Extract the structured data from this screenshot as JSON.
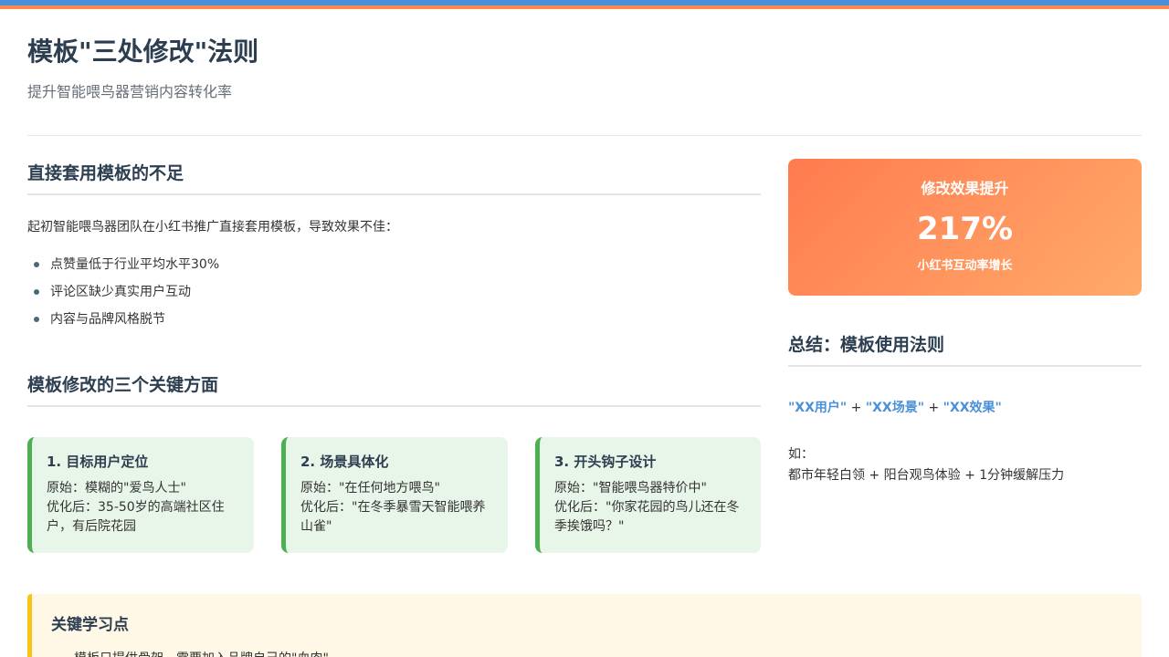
{
  "header": {
    "title": "模板\"三处修改\"法则",
    "subtitle": "提升智能喂鸟器营销内容转化率"
  },
  "problem": {
    "title": "直接套用模板的不足",
    "intro": "起初智能喂鸟器团队在小红书推广直接套用模板，导致效果不佳：",
    "bullets": [
      "点赞量低于行业平均水平30%",
      "评论区缺少真实用户互动",
      "内容与品牌风格脱节"
    ]
  },
  "aspects": {
    "title": "模板修改的三个关键方面",
    "cards": [
      {
        "title": "1. 目标用户定位",
        "lines": [
          "原始：模糊的\"爱鸟人士\"",
          "优化后：35-50岁的高端社区住",
          "户，有后院花园"
        ]
      },
      {
        "title": "2. 场景具体化",
        "lines": [
          "原始：\"在任何地方喂鸟\"",
          "优化后：\"在冬季暴雪天智能喂养",
          "山雀\""
        ]
      },
      {
        "title": "3. 开头钩子设计",
        "lines": [
          "原始：\"智能喂鸟器特价中\"",
          "优化后：\"你家花园的鸟儿还在冬",
          "季挨饿吗？\""
        ]
      }
    ]
  },
  "stat": {
    "label": "修改效果提升",
    "value": "217%",
    "caption": "小红书互动率增长"
  },
  "summary": {
    "title": "总结：模板使用法则",
    "formula": {
      "term1": "\"XX用户\"",
      "plus1": " + ",
      "term2": "\"XX场景\"",
      "plus2": " + ",
      "term3": "\"XX效果\""
    },
    "example_label": "如：",
    "example_text": "都市年轻白领 + 阳台观鸟体验 + 1分钟缓解压力"
  },
  "learning": {
    "title": "关键学习点",
    "item": "模板只提供骨架，需要加入品牌自己的\"血肉\""
  },
  "colors": {
    "accent_blue": "#4a90d9",
    "accent_orange": "#ff7b4f",
    "card_green": "#4caf50",
    "note_yellow": "#f5c518"
  }
}
